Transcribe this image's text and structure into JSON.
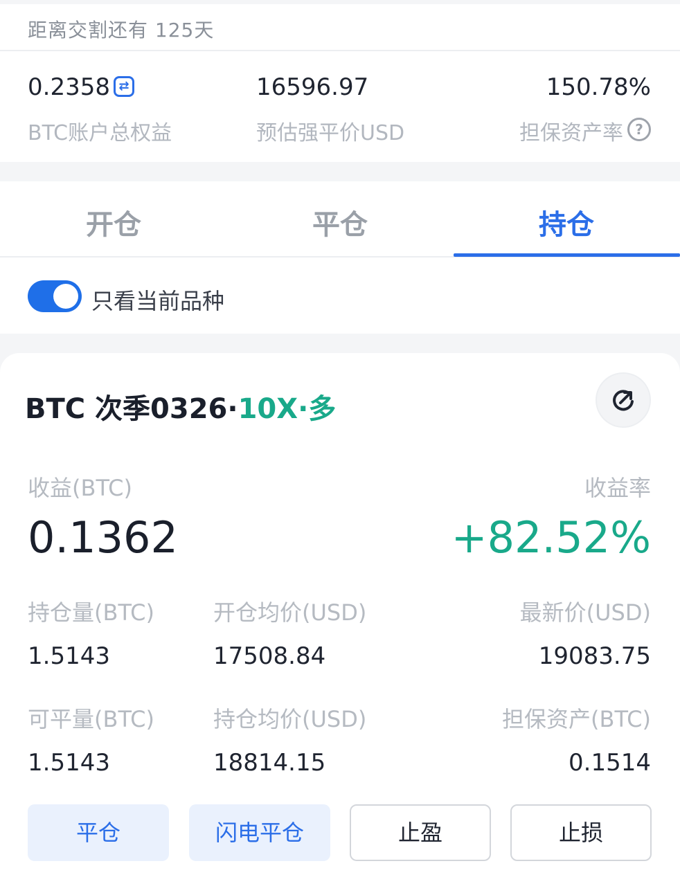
{
  "delivery": {
    "text": "距离交割还有 125天"
  },
  "account": {
    "equity_value": "0.2358",
    "equity_label": "BTC账户总权益",
    "liq_value": "16596.97",
    "liq_label": "预估强平价USD",
    "margin_ratio_value": "150.78%",
    "margin_ratio_label": "担保资产率"
  },
  "tabs": [
    {
      "label": "开仓",
      "active": false
    },
    {
      "label": "平仓",
      "active": false
    },
    {
      "label": "持仓",
      "active": true
    }
  ],
  "filter": {
    "label": "只看当前品种",
    "enabled": true
  },
  "position": {
    "title_main": "BTC 次季0326·",
    "title_leverage": "10X·多",
    "pnl_label": "收益(BTC)",
    "pnl_value": "0.1362",
    "rate_label": "收益率",
    "rate_value": "+82.52%",
    "fields": [
      {
        "label": "持仓量(BTC)",
        "value": "1.5143"
      },
      {
        "label": "开仓均价(USD)",
        "value": "17508.84"
      },
      {
        "label": "最新价(USD)",
        "value": "19083.75"
      },
      {
        "label": "可平量(BTC)",
        "value": "1.5143"
      },
      {
        "label": "持仓均价(USD)",
        "value": "18814.15"
      },
      {
        "label": "担保资产(BTC)",
        "value": "0.1514"
      }
    ]
  },
  "actions": {
    "close": "平仓",
    "flash_close": "闪电平仓",
    "take_profit": "止盈",
    "stop_loss": "止损"
  },
  "colors": {
    "accent": "#2b6ee8",
    "profit": "#19a98a"
  }
}
